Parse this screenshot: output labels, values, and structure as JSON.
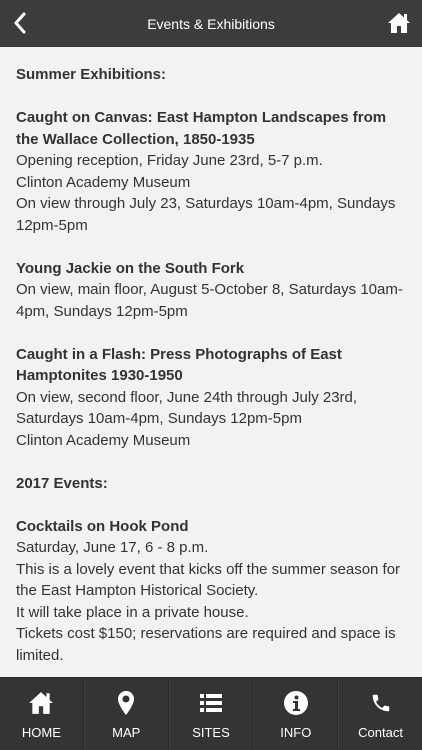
{
  "header": {
    "title": "Events & Exhibitions",
    "back_icon": "chevron-left-icon",
    "home_icon": "home-icon"
  },
  "content": {
    "summer_heading": "Summer Exhibitions:",
    "ex1": {
      "title": "Caught on Canvas: East Hampton Landscapes from the Wallace Collection, 1850-1935",
      "lines": [
        "Opening reception, Friday June 23rd, 5-7 p.m.",
        "Clinton Academy Museum",
        "On view through July 23, Saturdays 10am-4pm, Sundays 12pm-5pm"
      ]
    },
    "ex2": {
      "title": "Young Jackie on the South Fork",
      "lines": [
        "On view, main floor, August 5-October 8, Saturdays 10am-4pm, Sundays 12pm-5pm"
      ]
    },
    "ex3": {
      "title": "Caught in a Flash: Press Photographs of East Hamptonites 1930-1950",
      "lines": [
        "On view, second floor, June 24th through July 23rd, Saturdays 10am-4pm, Sundays 12pm-5pm",
        "Clinton Academy Museum"
      ]
    },
    "events_heading": "2017 Events:",
    "ev1": {
      "title": "Cocktails on Hook Pond",
      "lines": [
        "Saturday, June 17, 6 - 8 p.m.",
        "This is a lovely event that kicks off the summer season for the East Hampton Historical Society.",
        "It will take place in a private house.",
        "Tickets cost $150; reservations are required and space is limited."
      ]
    }
  },
  "tabbar": {
    "items": [
      {
        "label": "HOME",
        "icon": "home-icon"
      },
      {
        "label": "MAP",
        "icon": "map-pin-icon"
      },
      {
        "label": "SITES",
        "icon": "list-icon"
      },
      {
        "label": "INFO",
        "icon": "info-icon"
      },
      {
        "label": "Contact",
        "icon": "phone-icon"
      }
    ]
  },
  "colors": {
    "header_bg": "#3c3c3c",
    "tabbar_bg": "#343434",
    "content_bg": "#f2f2f2",
    "text": "#333333"
  }
}
